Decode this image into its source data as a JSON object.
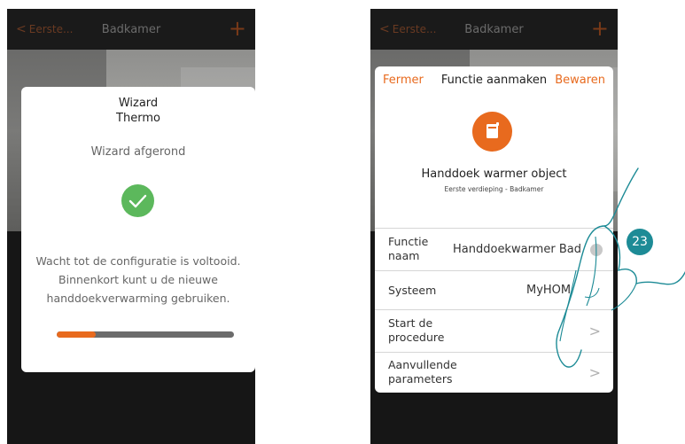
{
  "left_screen": {
    "navbar": {
      "back_label": "Eerste...",
      "title": "Badkamer",
      "add_icon": "plus-icon"
    },
    "wizard": {
      "title_line1": "Wizard",
      "title_line2": "Thermo",
      "status": "Wizard afgerond",
      "status_icon": "check-circle-icon",
      "message": "Wacht tot de configuratie is voltooid. Binnenkort kunt u de nieuwe handdoekverwarming gebruiken.",
      "progress": 0.22
    }
  },
  "right_screen": {
    "navbar": {
      "back_label": "Eerste...",
      "title": "Badkamer",
      "add_icon": "plus-icon"
    },
    "card": {
      "close_label": "Fermer",
      "title": "Functie aanmaken",
      "save_label": "Bewaren",
      "object_icon": "towel-warmer-icon",
      "object_name": "Handdoek warmer object",
      "object_location": "Eerste verdieping - Badkamer",
      "rows": [
        {
          "label": "Functie naam",
          "value": "Handdoekwarmer Bad",
          "trailing": "info-icon"
        },
        {
          "label": "Systeem",
          "value": "MyHOM"
        },
        {
          "label": "Start de procedure",
          "trailing": "chevron-right-icon"
        },
        {
          "label": "Aanvullende parameters",
          "trailing": "chevron-right-icon"
        }
      ]
    }
  },
  "step_badge": "23",
  "colors": {
    "accent": "#e86a1e",
    "success": "#5cb85c",
    "badge": "#1d8b96"
  }
}
